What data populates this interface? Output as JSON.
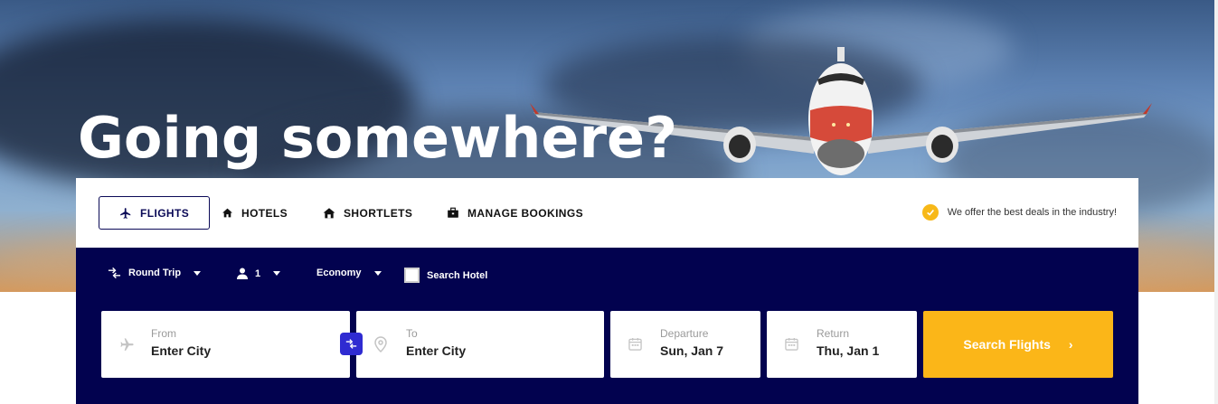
{
  "hero": {
    "headline": "Going somewhere?"
  },
  "tabs": [
    {
      "label": "FLIGHTS",
      "icon": "plane-icon",
      "active": true
    },
    {
      "label": "HOTELS",
      "icon": "home-icon",
      "active": false
    },
    {
      "label": "SHORTLETS",
      "icon": "house-icon",
      "active": false
    },
    {
      "label": "MANAGE BOOKINGS",
      "icon": "briefcase-icon",
      "active": false
    }
  ],
  "deal_note": "We offer the best deals in the industry!",
  "options": {
    "trip_type": "Round Trip",
    "passengers": "1",
    "cabin_class": "Economy",
    "search_hotel_label": "Search Hotel"
  },
  "fields": {
    "from": {
      "label": "From",
      "value": "Enter City"
    },
    "to": {
      "label": "To",
      "value": "Enter City"
    },
    "departure": {
      "label": "Departure",
      "value": "Sun, Jan 7"
    },
    "return": {
      "label": "Return",
      "value": "Thu, Jan 1"
    }
  },
  "search_button": {
    "label": "Search Flights",
    "arrow": "›"
  },
  "colors": {
    "navy": "#02024f",
    "accent": "#fbb618",
    "swap": "#2f2bd1"
  }
}
